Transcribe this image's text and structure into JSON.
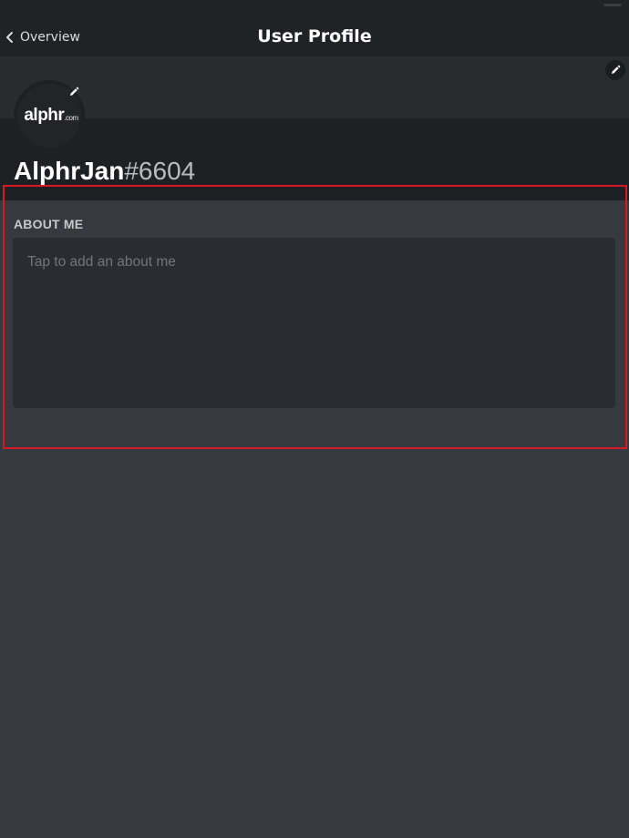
{
  "nav": {
    "back_label": "Overview",
    "title": "User Profile"
  },
  "profile": {
    "avatar_logo_main": "alphr",
    "avatar_logo_suffix": ".com",
    "username": "AlphrJan",
    "discriminator": "#6604"
  },
  "about_me": {
    "heading": "ABOUT ME",
    "placeholder": "Tap to add an about me",
    "value": ""
  },
  "annotation": {
    "highlight_color": "#d31a22"
  },
  "icons": {
    "back": "chevron-left-icon",
    "banner_edit": "pencil-icon",
    "avatar_edit": "pencil-icon"
  },
  "colors": {
    "background": "#36393f",
    "nav_background": "#202225",
    "banner": "#2a2b2f",
    "text_primary": "#ffffff",
    "text_muted": "#72767d"
  }
}
